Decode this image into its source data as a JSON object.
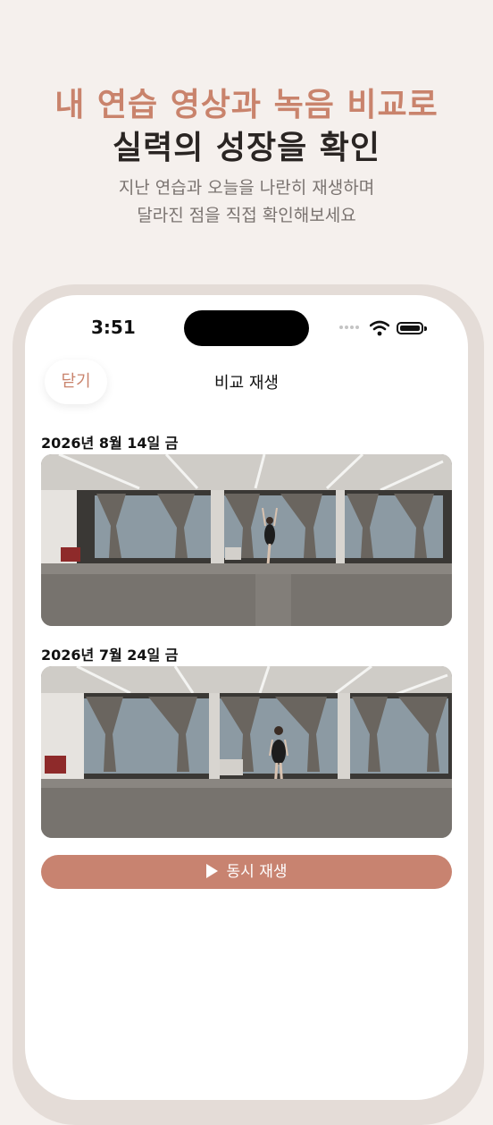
{
  "colors": {
    "accent": "#c9836c",
    "button": "#c88370",
    "background": "#f5f0ed"
  },
  "hero": {
    "accent_line": "내 연습 영상과 녹음 비교로",
    "title_line": "실력의 성장을 확인",
    "sub_line1": "지난 연습과 오늘을 나란히 재생하며",
    "sub_line2": "달라진 점을 직접 확인해보세요"
  },
  "status_bar": {
    "time": "3:51"
  },
  "nav": {
    "close_label": "닫기",
    "title": "비교 재생"
  },
  "recordings": [
    {
      "date": "2026년 8월 14일 금",
      "thumbnail": "dance-studio-video-1"
    },
    {
      "date": "2026년 7월 24일 금",
      "thumbnail": "dance-studio-video-2"
    }
  ],
  "actions": {
    "play_together_label": "동시 재생",
    "play_icon": "play-icon"
  }
}
